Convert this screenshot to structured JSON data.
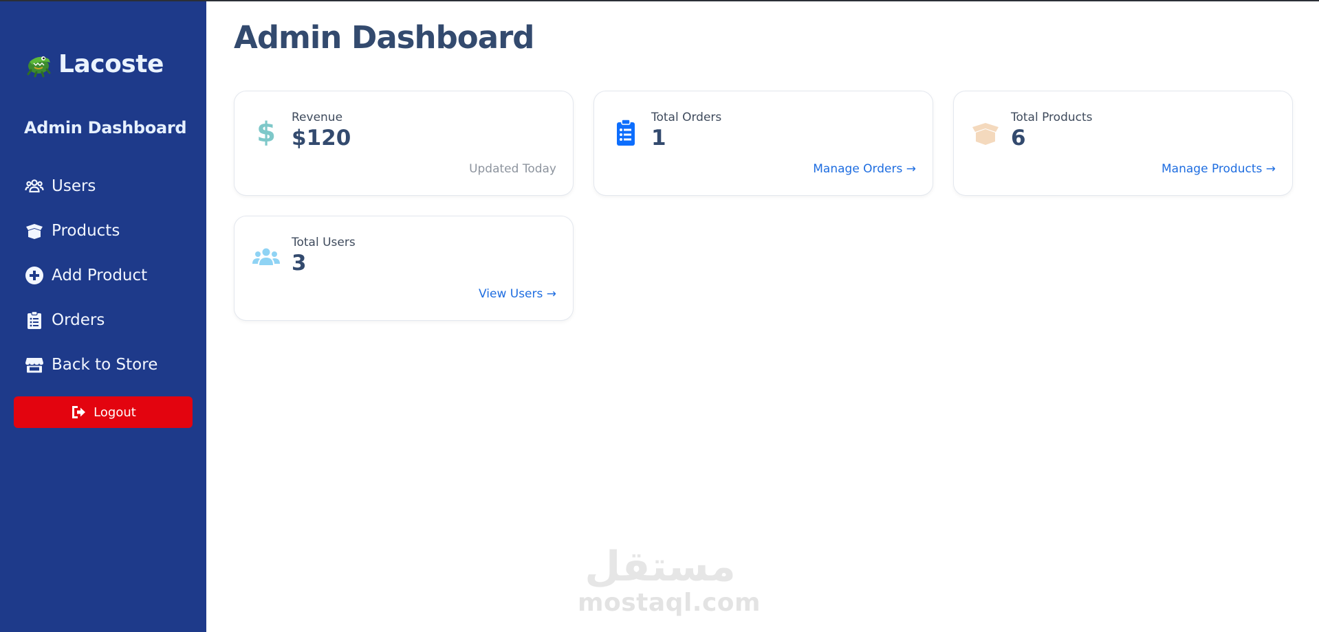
{
  "brand": {
    "name": "Lacoste",
    "logo": "crocodile-logo"
  },
  "sidebar": {
    "title": "Admin Dashboard",
    "items": [
      {
        "label": "Users",
        "icon": "users-icon"
      },
      {
        "label": "Products",
        "icon": "box-open-icon"
      },
      {
        "label": "Add Product",
        "icon": "plus-circle-icon"
      },
      {
        "label": "Orders",
        "icon": "clipboard-list-icon"
      },
      {
        "label": "Back to Store",
        "icon": "store-icon"
      }
    ],
    "logout_label": "Logout"
  },
  "main": {
    "title": "Admin Dashboard",
    "cards": [
      {
        "label": "Revenue",
        "value": "$120",
        "note": "Updated Today",
        "icon": "dollar-icon",
        "icon_color": "#7ec8c9"
      },
      {
        "label": "Total Orders",
        "value": "1",
        "link": "Manage Orders →",
        "icon": "clipboard-list-icon",
        "icon_color": "#0d6efd"
      },
      {
        "label": "Total Products",
        "value": "6",
        "link": "Manage Products →",
        "icon": "box-open-icon",
        "icon_color": "#f4d9bd"
      },
      {
        "label": "Total Users",
        "value": "3",
        "link": "View Users →",
        "icon": "users-icon",
        "icon_color": "#8fd3f4"
      }
    ]
  },
  "watermark": {
    "arabic": "مستقل",
    "latin": "mostaql.com"
  },
  "colors": {
    "sidebar": "#1e3a8a",
    "logout": "#e3040f",
    "link": "#1e6de0",
    "title": "#334a6e"
  }
}
